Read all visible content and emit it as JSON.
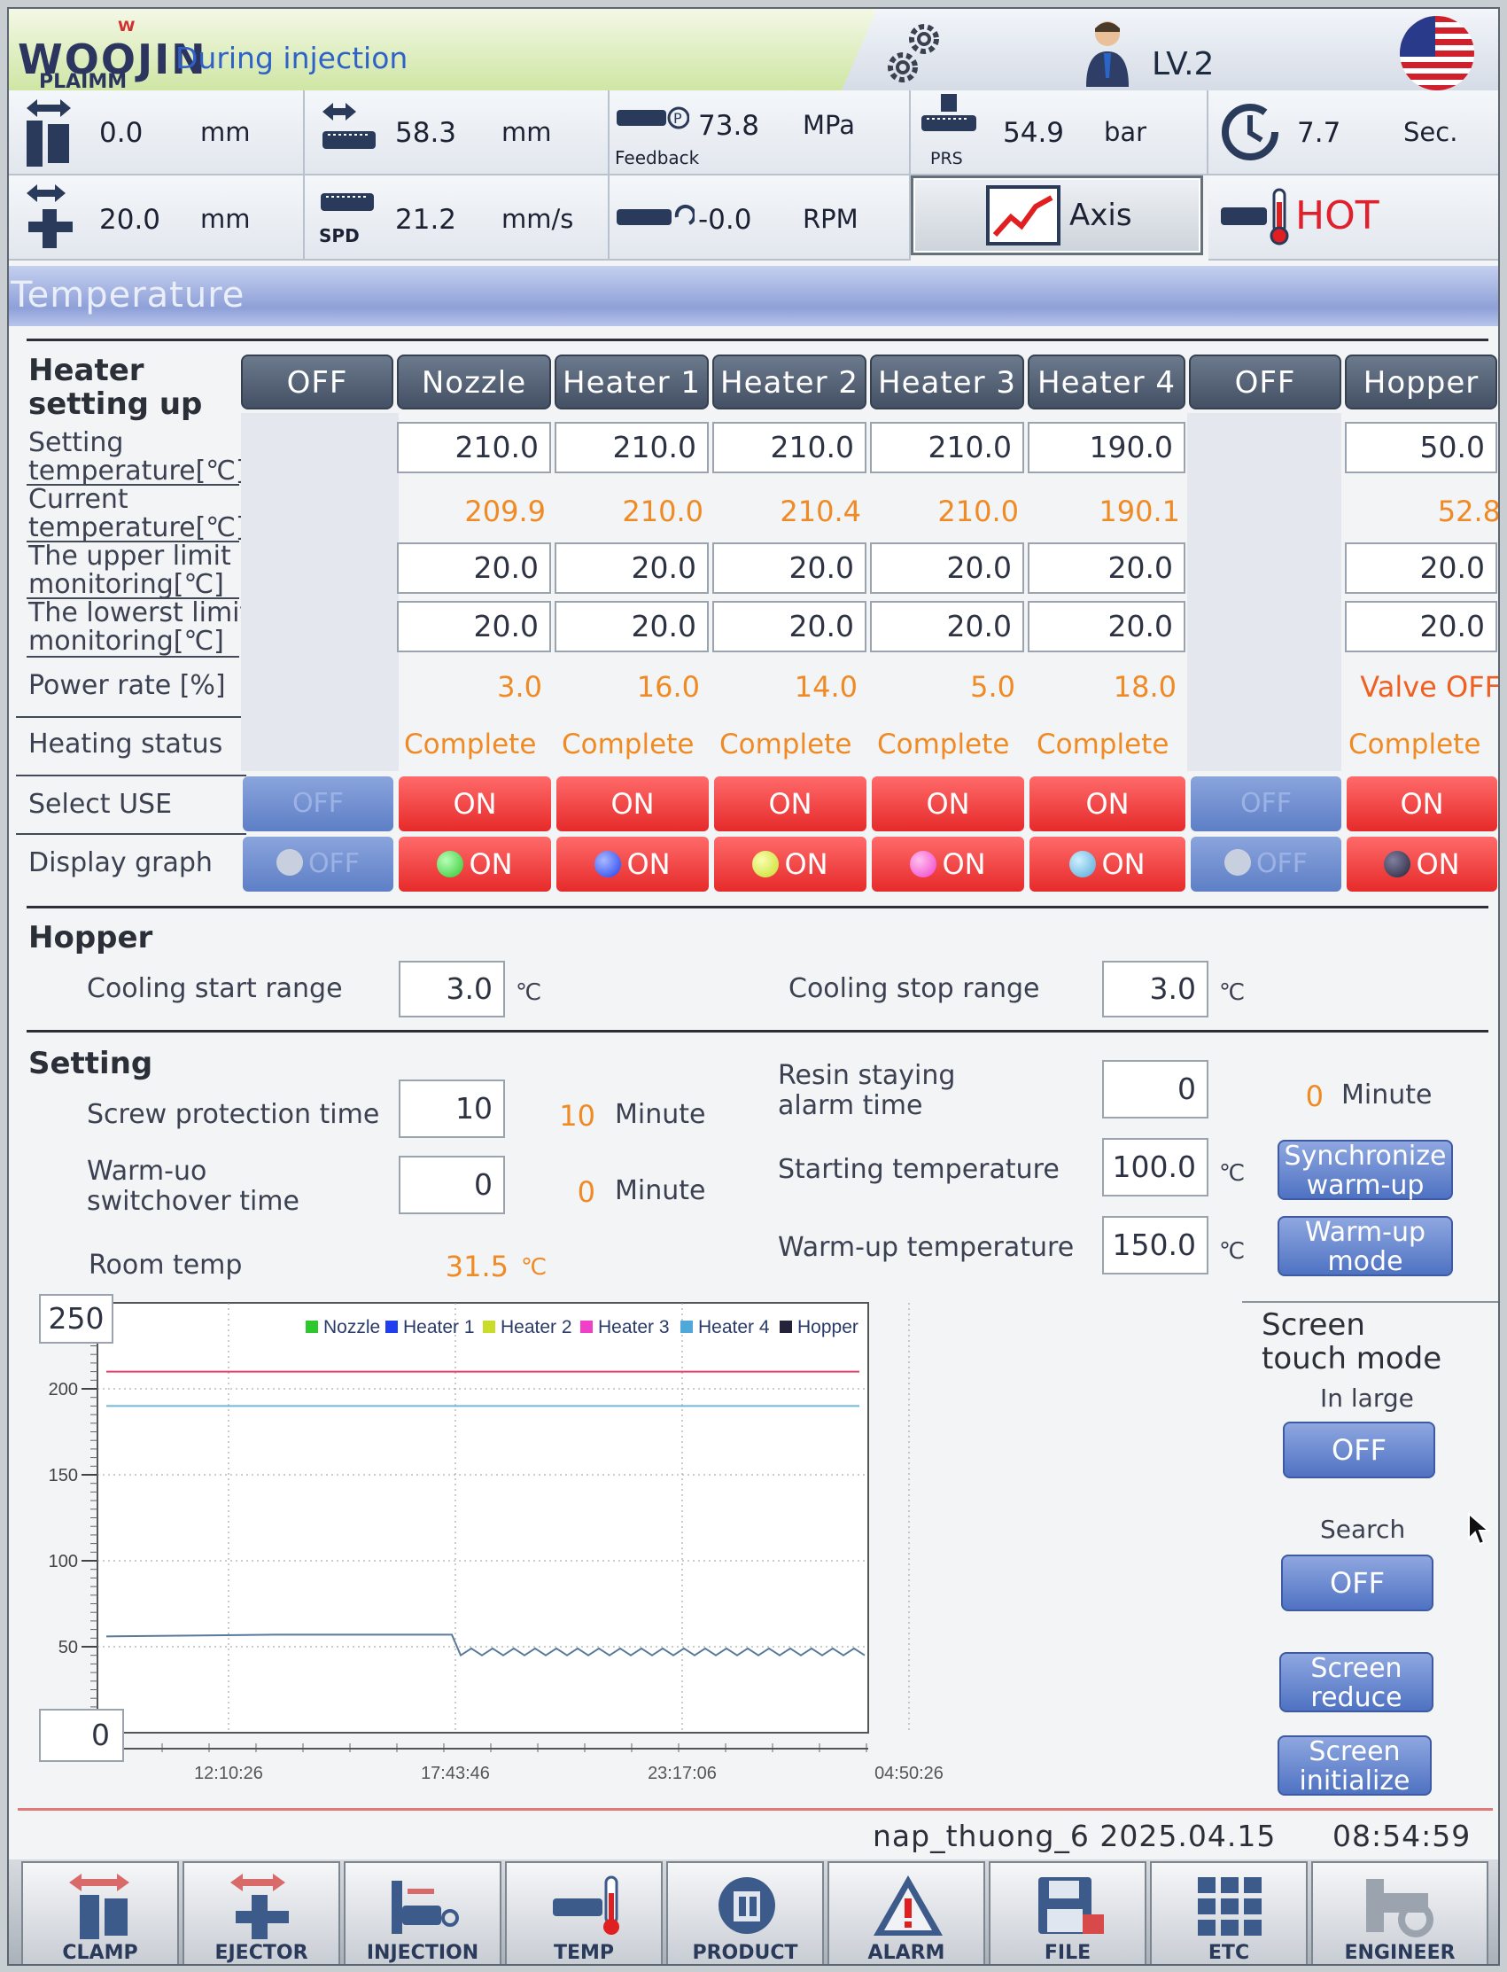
{
  "header": {
    "brand": "WOOJIN",
    "brand_sub": "PLAIMM",
    "status": "During injection",
    "level": "LV.2"
  },
  "readouts": {
    "clamp_pos": {
      "value": "0.0",
      "unit": "mm"
    },
    "screw_pos": {
      "value": "58.3",
      "unit": "mm"
    },
    "inj_pressure": {
      "value": "73.8",
      "unit": "MPa",
      "label": "Feedback"
    },
    "back_pressure": {
      "value": "54.9",
      "unit": "bar",
      "label": "PRS"
    },
    "cycle_time": {
      "value": "7.7",
      "unit": "Sec."
    },
    "ejector_pos": {
      "value": "20.0",
      "unit": "mm"
    },
    "inj_speed": {
      "value": "21.2",
      "unit": "mm/s",
      "label": "SPD"
    },
    "screw_rpm": {
      "value": "-0.0",
      "unit": "RPM"
    },
    "axis_label": "Axis",
    "hot_label": "HOT"
  },
  "section_title": "Temperature",
  "heater": {
    "title_line1": "Heater",
    "title_line2": "setting up",
    "row_labels": {
      "setting1": "Setting",
      "setting2": "temperature[℃]",
      "current1": "Current",
      "current2": "temperature[℃]",
      "upper1": "The upper limit",
      "upper2": "monitoring[℃]",
      "lower1": "The lowerst limit",
      "lower2": "monitoring[℃]",
      "power": "Power rate [%]",
      "status": "Heating status",
      "select": "Select USE",
      "graph": "Display graph"
    },
    "zones": [
      {
        "name": "OFF",
        "active": false
      },
      {
        "name": "Nozzle",
        "active": true,
        "set": "210.0",
        "cur": "209.9",
        "upper": "20.0",
        "lower": "20.0",
        "power": "3.0",
        "status": "Complete",
        "use": "ON",
        "graph": "ON",
        "color": "#2ec82e"
      },
      {
        "name": "Heater 1",
        "active": true,
        "set": "210.0",
        "cur": "210.0",
        "upper": "20.0",
        "lower": "20.0",
        "power": "16.0",
        "status": "Complete",
        "use": "ON",
        "graph": "ON",
        "color": "#1e3ef0"
      },
      {
        "name": "Heater 2",
        "active": true,
        "set": "210.0",
        "cur": "210.4",
        "upper": "20.0",
        "lower": "20.0",
        "power": "14.0",
        "status": "Complete",
        "use": "ON",
        "graph": "ON",
        "color": "#c8dc28"
      },
      {
        "name": "Heater 3",
        "active": true,
        "set": "210.0",
        "cur": "210.0",
        "upper": "20.0",
        "lower": "20.0",
        "power": "5.0",
        "status": "Complete",
        "use": "ON",
        "graph": "ON",
        "color": "#f040c8"
      },
      {
        "name": "Heater 4",
        "active": true,
        "set": "190.0",
        "cur": "190.1",
        "upper": "20.0",
        "lower": "20.0",
        "power": "18.0",
        "status": "Complete",
        "use": "ON",
        "graph": "ON",
        "color": "#50a8d8"
      },
      {
        "name": "OFF",
        "active": false
      },
      {
        "name": "Hopper",
        "active": true,
        "set": "50.0",
        "cur": "52.8",
        "upper": "20.0",
        "lower": "20.0",
        "power": "Valve OFF",
        "status": "Complete",
        "use": "ON",
        "graph": "ON",
        "color": "#23233a"
      }
    ],
    "off_label": "OFF"
  },
  "hopper": {
    "title": "Hopper",
    "cool_start_label": "Cooling start range",
    "cool_start": "3.0",
    "cool_stop_label": "Cooling stop range",
    "cool_stop": "3.0",
    "unit": "℃"
  },
  "setting": {
    "title": "Setting",
    "screw_label": "Screw protection time",
    "screw_val": "10",
    "screw_cur": "10",
    "screw_unit": "Minute",
    "warm_label1": "Warm-uo",
    "warm_label2": "switchover time",
    "warm_val": "0",
    "warm_cur": "0",
    "warm_unit": "Minute",
    "room_label": "Room temp",
    "room_val": "31.5",
    "room_unit": "℃",
    "resin_label1": "Resin staying",
    "resin_label2": "alarm time",
    "resin_val": "0",
    "resin_cur": "0",
    "resin_unit": "Minute",
    "start_label": "Starting temperature",
    "start_val": "100.0",
    "start_unit": "℃",
    "warmtemp_label": "Warm-up temperature",
    "warmtemp_val": "150.0",
    "warmtemp_unit": "℃",
    "sync_btn1": "Synchronize",
    "sync_btn2": "warm-up",
    "warmmode_btn1": "Warm-up",
    "warmmode_btn2": "mode"
  },
  "side": {
    "title1": "Screen",
    "title2": "touch mode",
    "large_label": "In large",
    "large_btn": "OFF",
    "search_label": "Search",
    "search_btn": "OFF",
    "reduce1": "Screen",
    "reduce2": "reduce",
    "init1": "Screen",
    "init2": "initialize"
  },
  "chart_data": {
    "type": "line",
    "x_ticks": [
      "12:10:26",
      "17:43:46",
      "23:17:06",
      "04:50:26"
    ],
    "ylim": [
      0,
      250
    ],
    "y_ticks": [
      0,
      50,
      100,
      150,
      200,
      250
    ],
    "ymax_box": "250",
    "ymin_box": "0",
    "legend": [
      "Nozzle",
      "Heater 1",
      "Heater 2",
      "Heater 3",
      "Heater 4",
      "Hopper"
    ],
    "series": [
      {
        "name": "Heater 3",
        "color": "#e0406a",
        "values": [
          210,
          210,
          210,
          210,
          210,
          210,
          210,
          210,
          210
        ]
      },
      {
        "name": "Heater 4",
        "color": "#70b8d8",
        "values": [
          190,
          190,
          190,
          190,
          190,
          190,
          190,
          190,
          190
        ]
      },
      {
        "name": "Hopper",
        "color": "#5a7a9a",
        "values": [
          56,
          56,
          57,
          57,
          57,
          57,
          45,
          48,
          46,
          48,
          47,
          48,
          46,
          48,
          47
        ]
      }
    ],
    "grid": true,
    "legend_position": "top"
  },
  "footer": {
    "info": "nap_thuong_6  2025.04.15",
    "time": "08:54:59"
  },
  "nav": [
    "CLAMP",
    "EJECTOR",
    "INJECTION",
    "TEMP",
    "PRODUCT",
    "ALARM",
    "FILE",
    "ETC",
    "ENGINEER"
  ]
}
